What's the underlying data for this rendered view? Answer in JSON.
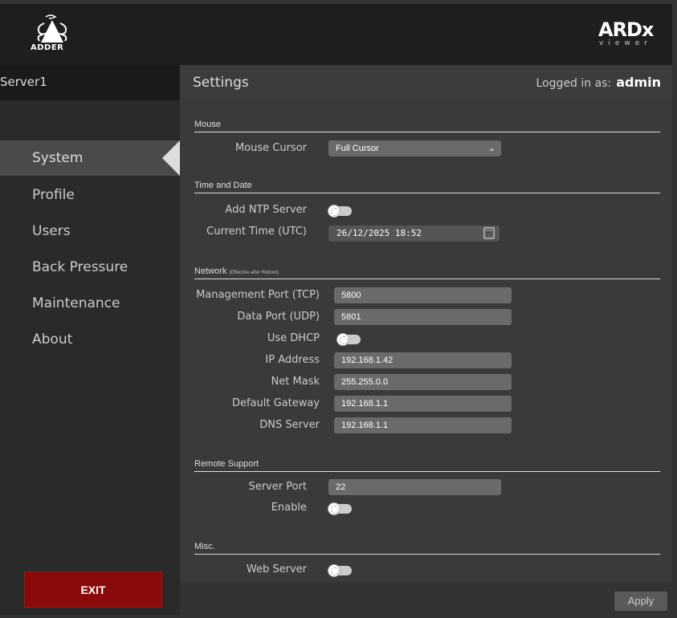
{
  "header": {
    "brand_left": "ADDER",
    "brand_right": "ARDx",
    "brand_right_sub": "viewer"
  },
  "server": {
    "name": "Server1"
  },
  "title": {
    "page": "Settings",
    "login_prefix": "Logged in as:",
    "user": "admin"
  },
  "sidebar": {
    "items": [
      {
        "label": "System",
        "active": true
      },
      {
        "label": "Profile"
      },
      {
        "label": "Users"
      },
      {
        "label": "Back Pressure"
      },
      {
        "label": "Maintenance"
      },
      {
        "label": "About"
      }
    ],
    "exit_label": "EXIT"
  },
  "sections": {
    "mouse": {
      "title": "Mouse",
      "cursor_label": "Mouse Cursor",
      "cursor_value": "Full Cursor"
    },
    "time": {
      "title": "Time and Date",
      "ntp_label": "Add NTP Server",
      "time_label": "Current Time (UTC)",
      "time_value": "26/12/2025 18:52"
    },
    "network": {
      "title": "Network",
      "note": "(Effective after Reboot)",
      "mgmt_port_label": "Management Port (TCP)",
      "mgmt_port_value": "5800",
      "data_port_label": "Data Port (UDP)",
      "data_port_value": "5801",
      "dhcp_label": "Use DHCP",
      "ip_label": "IP Address",
      "ip_value": "192.168.1.42",
      "mask_label": "Net Mask",
      "mask_value": "255.255.0.0",
      "gw_label": "Default Gateway",
      "gw_value": "192.168.1.1",
      "dns_label": "DNS Server",
      "dns_value": "192.168.1.1"
    },
    "remote": {
      "title": "Remote Support",
      "port_label": "Server Port",
      "port_value": "22",
      "enable_label": "Enable"
    },
    "misc": {
      "title": "Misc.",
      "web_label": "Web Server"
    }
  },
  "footer": {
    "apply_label": "Apply"
  },
  "colors": {
    "exit_button": "#8a0a0a",
    "content_bg": "#3a3a3a",
    "sidebar_bg": "#2a2a2a"
  }
}
